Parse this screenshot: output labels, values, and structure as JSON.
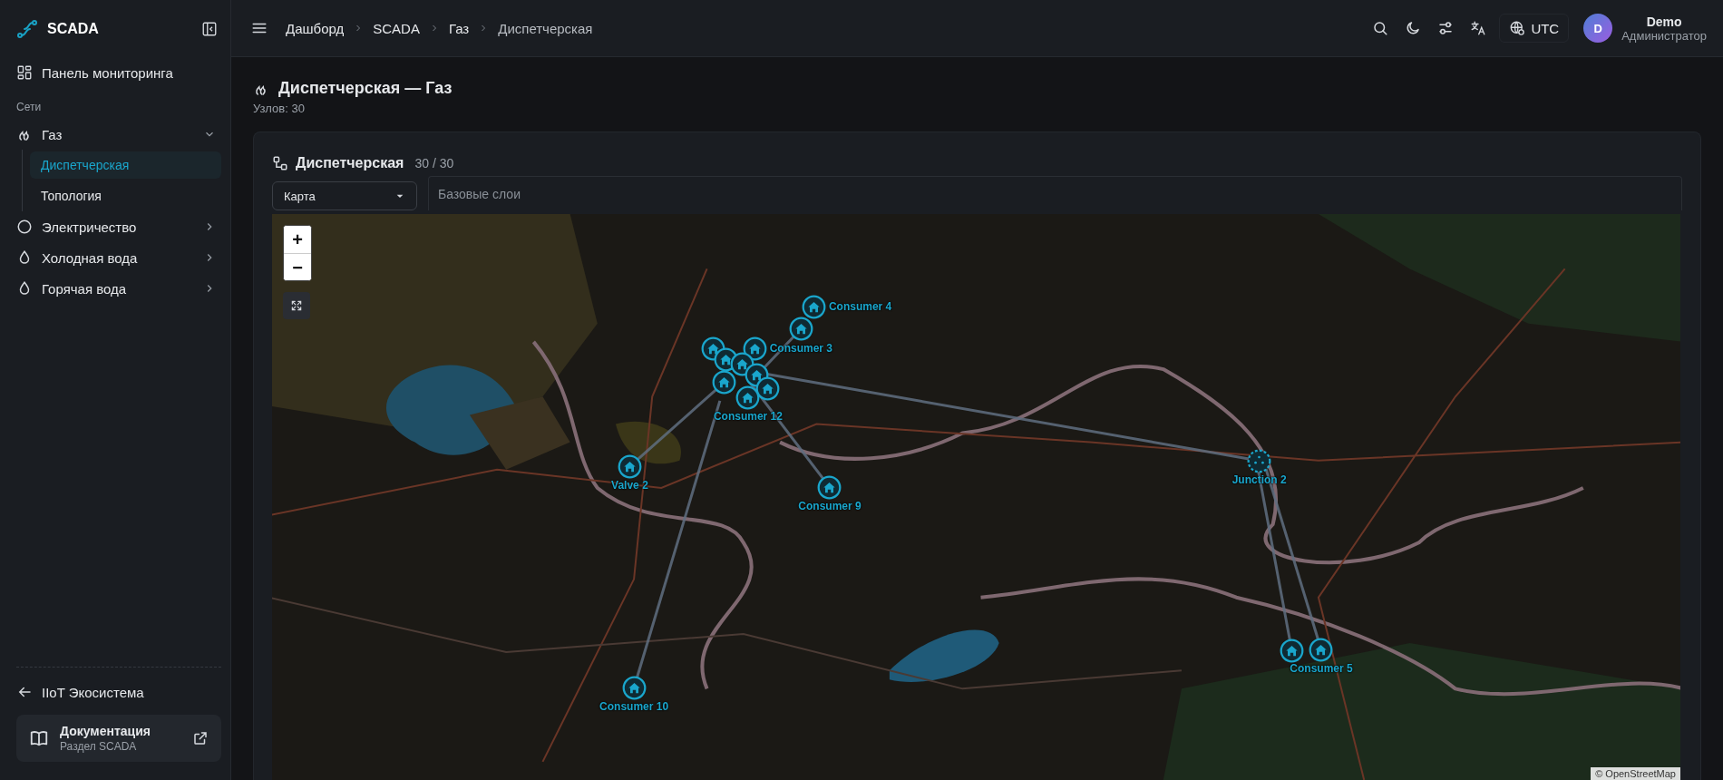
{
  "sidebar": {
    "brand": "SCADA",
    "items": [
      {
        "label": "Панель мониторинга",
        "kind": "dashboard"
      }
    ],
    "section": "Сети",
    "networks": [
      {
        "label": "Газ",
        "kind": "flame",
        "expanded": true,
        "children": [
          {
            "label": "Диспетчерская",
            "selected": true
          },
          {
            "label": "Топология",
            "selected": false
          }
        ]
      },
      {
        "label": "Электричество",
        "kind": "circle",
        "expanded": false
      },
      {
        "label": "Холодная вода",
        "kind": "drop",
        "expanded": false
      },
      {
        "label": "Горячая вода",
        "kind": "drop",
        "expanded": false
      }
    ],
    "back_link": "IIoT Экосистема",
    "docs": {
      "title": "Документация",
      "subtitle": "Раздел SCADA"
    }
  },
  "header": {
    "breadcrumbs": [
      "Дашборд",
      "SCADA",
      "Газ",
      "Диспетчерская"
    ],
    "timezone": "UTC",
    "user": {
      "initial": "D",
      "name": "Demo",
      "role": "Администратор"
    }
  },
  "page": {
    "title": "Диспетчерская — Газ",
    "subtitle": "Узлов: 30"
  },
  "card": {
    "title": "Диспетчерская",
    "count": "30 / 30",
    "view_select": "Карта",
    "layers_placeholder": "Базовые слои",
    "map": {
      "zoom_in": "+",
      "zoom_out": "−",
      "attribution": "© OpenStreetMap",
      "nodes": [
        {
          "kind": "consumer",
          "label": "Consumer 4"
        },
        {
          "kind": "consumer"
        },
        {
          "kind": "consumer",
          "label": "Consumer 3"
        },
        {
          "kind": "consumer"
        },
        {
          "kind": "consumer"
        },
        {
          "kind": "consumer"
        },
        {
          "kind": "consumer"
        },
        {
          "kind": "consumer"
        },
        {
          "kind": "consumer"
        },
        {
          "kind": "consumer",
          "label": "Consumer 12"
        },
        {
          "kind": "valve",
          "label": "Valve 2"
        },
        {
          "kind": "consumer",
          "label": "Consumer 9"
        },
        {
          "kind": "junction",
          "label": "Junction 2"
        },
        {
          "kind": "consumer"
        },
        {
          "kind": "consumer",
          "label": "Consumer 5"
        },
        {
          "kind": "consumer",
          "label": "Consumer 10"
        }
      ]
    }
  }
}
